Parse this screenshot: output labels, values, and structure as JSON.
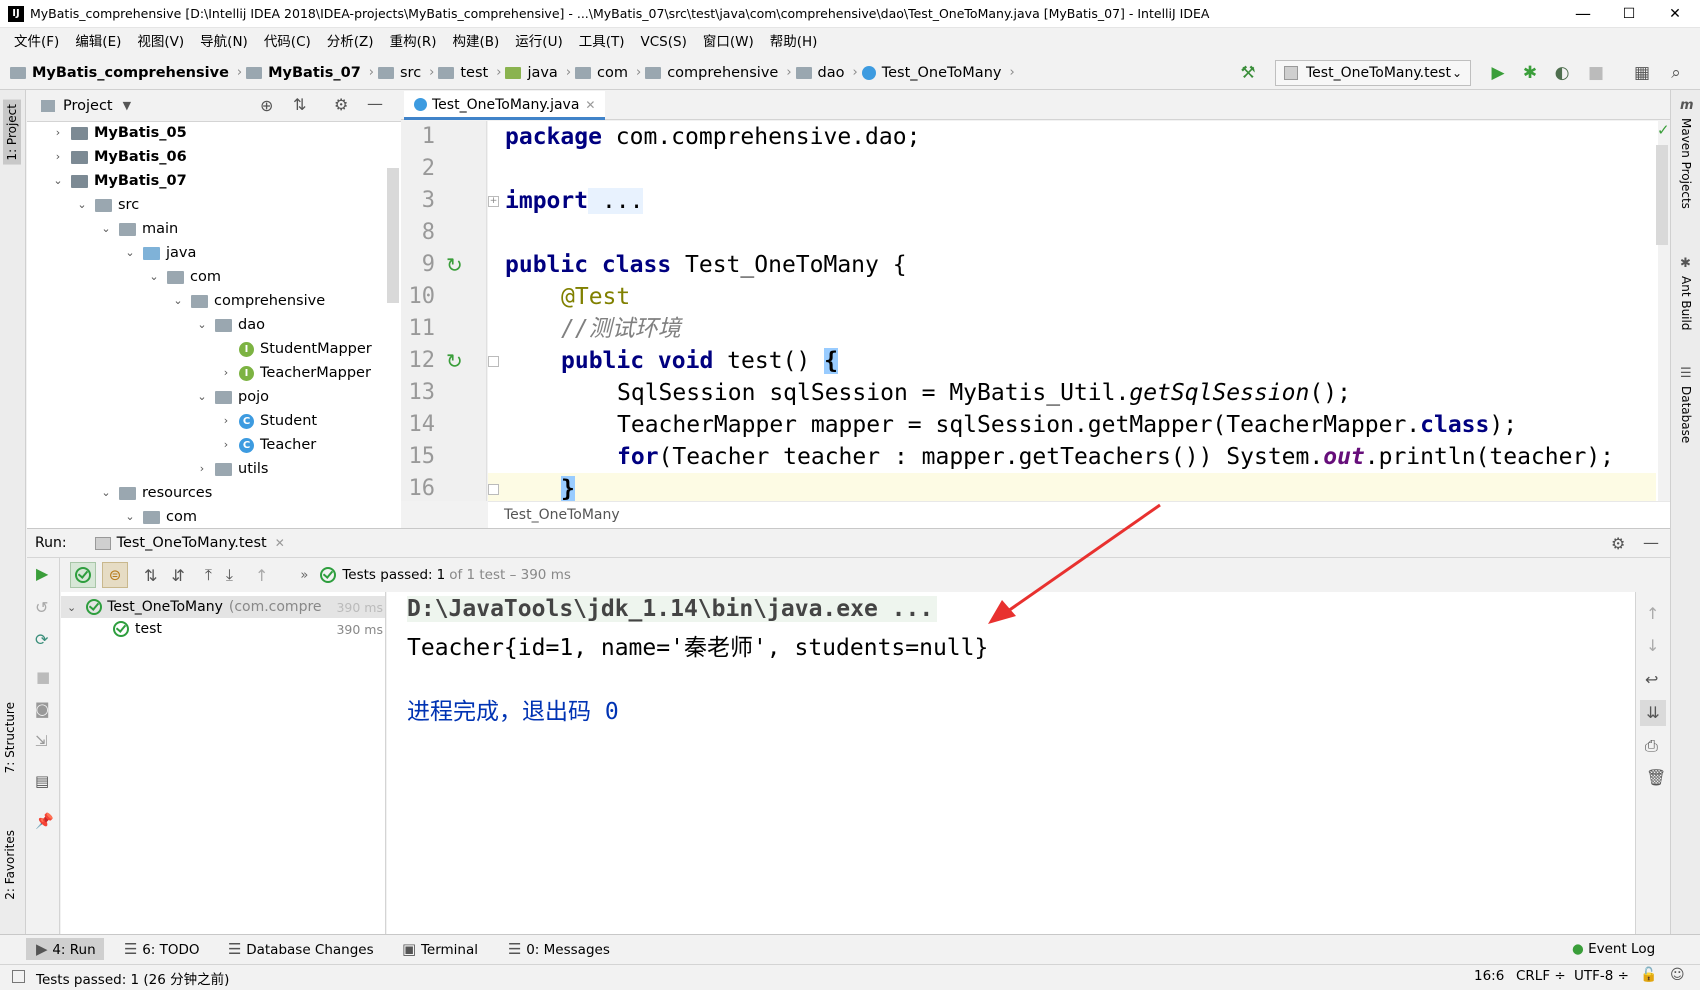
{
  "window": {
    "title": "MyBatis_comprehensive [D:\\Intellij IDEA 2018\\IDEA-projects\\MyBatis_comprehensive] - ...\\MyBatis_07\\src\\test\\java\\com\\comprehensive\\dao\\Test_OneToMany.java [MyBatis_07] - IntelliJ IDEA",
    "logo": "IJ",
    "minimize": "—",
    "maximize": "☐",
    "close": "✕"
  },
  "menu": [
    "文件(F)",
    "编辑(E)",
    "视图(V)",
    "导航(N)",
    "代码(C)",
    "分析(Z)",
    "重构(R)",
    "构建(B)",
    "运行(U)",
    "工具(T)",
    "VCS(S)",
    "窗口(W)",
    "帮助(H)"
  ],
  "breadcrumbs": [
    "MyBatis_comprehensive",
    "MyBatis_07",
    "src",
    "test",
    "java",
    "com",
    "comprehensive",
    "dao",
    "Test_OneToMany"
  ],
  "run_config": "Test_OneToMany.test",
  "project_panel": {
    "title": "Project",
    "tree": [
      {
        "label": "MyBatis_05",
        "indent": 0,
        "arrow": "›",
        "icon": "module",
        "bold": true
      },
      {
        "label": "MyBatis_06",
        "indent": 0,
        "arrow": "›",
        "icon": "module",
        "bold": true
      },
      {
        "label": "MyBatis_07",
        "indent": 0,
        "arrow": "⌄",
        "icon": "module",
        "bold": true
      },
      {
        "label": "src",
        "indent": 1,
        "arrow": "⌄",
        "icon": "folder"
      },
      {
        "label": "main",
        "indent": 2,
        "arrow": "⌄",
        "icon": "folder"
      },
      {
        "label": "java",
        "indent": 3,
        "arrow": "⌄",
        "icon": "folder-blue"
      },
      {
        "label": "com",
        "indent": 4,
        "arrow": "⌄",
        "icon": "folder"
      },
      {
        "label": "comprehensive",
        "indent": 5,
        "arrow": "⌄",
        "icon": "folder"
      },
      {
        "label": "dao",
        "indent": 6,
        "arrow": "⌄",
        "icon": "folder"
      },
      {
        "label": "StudentMapper",
        "indent": 7,
        "arrow": "",
        "icon": "interface"
      },
      {
        "label": "TeacherMapper",
        "indent": 7,
        "arrow": "›",
        "icon": "interface"
      },
      {
        "label": "pojo",
        "indent": 6,
        "arrow": "⌄",
        "icon": "folder"
      },
      {
        "label": "Student",
        "indent": 7,
        "arrow": "›",
        "icon": "class"
      },
      {
        "label": "Teacher",
        "indent": 7,
        "arrow": "›",
        "icon": "class"
      },
      {
        "label": "utils",
        "indent": 6,
        "arrow": "›",
        "icon": "folder"
      },
      {
        "label": "resources",
        "indent": 2,
        "arrow": "⌄",
        "icon": "folder"
      },
      {
        "label": "com",
        "indent": 3,
        "arrow": "⌄",
        "icon": "folder"
      }
    ]
  },
  "editor": {
    "tab": "Test_OneToMany.java",
    "line_numbers": [
      "1",
      "2",
      "3",
      "8",
      "9",
      "10",
      "11",
      "12",
      "13",
      "14",
      "15",
      "16"
    ],
    "status_label": "Test_OneToMany",
    "code": {
      "l1_kw": "package",
      "l1_rest": " com.comprehensive.dao;",
      "l3_kw": "import",
      "l3_rest": " ...",
      "l9_kw": "public class",
      "l9_rest": " Test_OneToMany {",
      "l10_an": "@Test",
      "l11_cm": "//测试环境",
      "l12_kw": "public void",
      "l12_rest": " test() ",
      "l12_brace": "{",
      "l13_a": "SqlSession sqlSession = MyBatis_Util.",
      "l13_i": "getSqlSession",
      "l13_b": "();",
      "l14_a": "TeacherMapper mapper = sqlSession.getMapper(TeacherMapper.",
      "l14_kw": "class",
      "l14_b": ");",
      "l15_kw": "for",
      "l15_a": "(Teacher teacher : mapper.getTeachers()) System.",
      "l15_f": "out",
      "l15_b": ".println(teacher);",
      "l16": "}"
    }
  },
  "run_panel": {
    "label": "Run:",
    "tab": "Test_OneToMany.test",
    "status_prefix": "Tests passed:",
    "status_count": "1",
    "status_suffix": "of 1 test – 390 ms",
    "tree": [
      {
        "label": "Test_OneToMany",
        "detail": "(com.compreh",
        "time": "390 ms"
      },
      {
        "label": "test",
        "detail": "",
        "time": "390 ms"
      }
    ],
    "console": [
      "D:\\JavaTools\\jdk_1.14\\bin\\java.exe ...",
      "Teacher{id=1, name='秦老师', students=null}",
      "进程完成，退出码 0"
    ]
  },
  "side_tabs": {
    "left": [
      "1: Project",
      "7: Structure",
      "2: Favorites"
    ],
    "right": [
      "Maven Projects",
      "Ant Build",
      "Database"
    ]
  },
  "tool_windows": [
    "4: Run",
    "6: TODO",
    "Database Changes",
    "Terminal",
    "0: Messages"
  ],
  "event_log": "Event Log",
  "status_bar": {
    "message": "Tests passed: 1 (26 分钟之前)",
    "position": "16:6",
    "line_sep": "CRLF ÷",
    "encoding": "UTF-8 ÷"
  },
  "colors": {
    "keyword": "#000080",
    "annotation": "#808000",
    "comment": "#808080",
    "console_exit": "#0033b3",
    "arrow": "#e8312f"
  }
}
